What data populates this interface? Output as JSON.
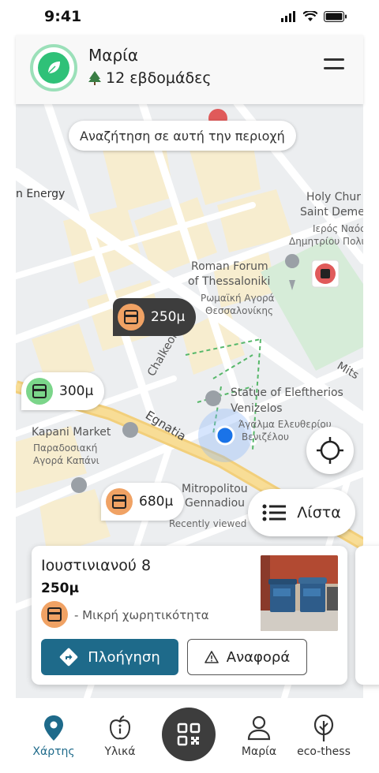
{
  "status_bar": {
    "time": "9:41"
  },
  "header": {
    "user_name": "Μαρία",
    "weeks": "12 εβδομάδες",
    "logo_icon": "leaf-icon",
    "menu_icon": "menu-icon"
  },
  "map": {
    "search_here": "Αναζήτηση σε αυτή την περιοχή",
    "labels": {
      "energy": "n Energy",
      "church_en_1": "Holy Chur",
      "church_en_2": "Saint Deme",
      "church_gr_1": "Ιερός Ναός",
      "church_gr_2": "Δημητρίου Πολιού",
      "forum_en_1": "Roman Forum",
      "forum_en_2": "of Thessaloniki",
      "forum_gr_1": "Ρωμαϊκή Αγορά",
      "forum_gr_2": "Θεσσαλονίκης",
      "chalkeon": "Chalkeon",
      "egnatia": "Egnatia",
      "statue_en_1": "Statue of Eleftherios",
      "statue_en_2": "Venizelos",
      "statue_gr_1": "Άγαλμα Ελευθερίου",
      "statue_gr_2": "Βενιζέλου",
      "kapani_en": "Kapani Market",
      "kapani_gr_1": "Παραδοσιακή",
      "kapani_gr_2": "Αγορά Καπάνι",
      "mitropolitou_1": "Mitropolitou",
      "mitropolitou_2": "Gennadiou",
      "recently_viewed": "Recently viewed",
      "mits": "Mits"
    },
    "markers": [
      {
        "distance": "250μ",
        "color": "#f0a264",
        "style": "selected"
      },
      {
        "distance": "300μ",
        "color": "#7bd58a",
        "style": "normal"
      },
      {
        "distance": "680μ",
        "color": "#f0a264",
        "style": "normal"
      }
    ],
    "list_button": "Λίστα"
  },
  "card": {
    "address": "Ιουστινιανού 8",
    "distance": "250μ",
    "type": "- Μικρή χωρητικότητα",
    "navigate": "Πλοήγηση",
    "report": "Αναφορά"
  },
  "tabs": [
    {
      "label": "Χάρτης",
      "icon": "map-pin-icon",
      "active": true
    },
    {
      "label": "Υλικά",
      "icon": "apple-info-icon",
      "active": false
    },
    {
      "label": "",
      "icon": "qr-code-icon",
      "active": false
    },
    {
      "label": "Μαρία",
      "icon": "user-icon",
      "active": false
    },
    {
      "label": "eco-thess",
      "icon": "tree-icon",
      "active": false
    }
  ],
  "colors": {
    "accent": "#1e6a8a",
    "brand_green": "#2fc178",
    "bin_orange": "#f0a264",
    "bin_green": "#7bd58a",
    "user_location": "#1a73e8"
  }
}
